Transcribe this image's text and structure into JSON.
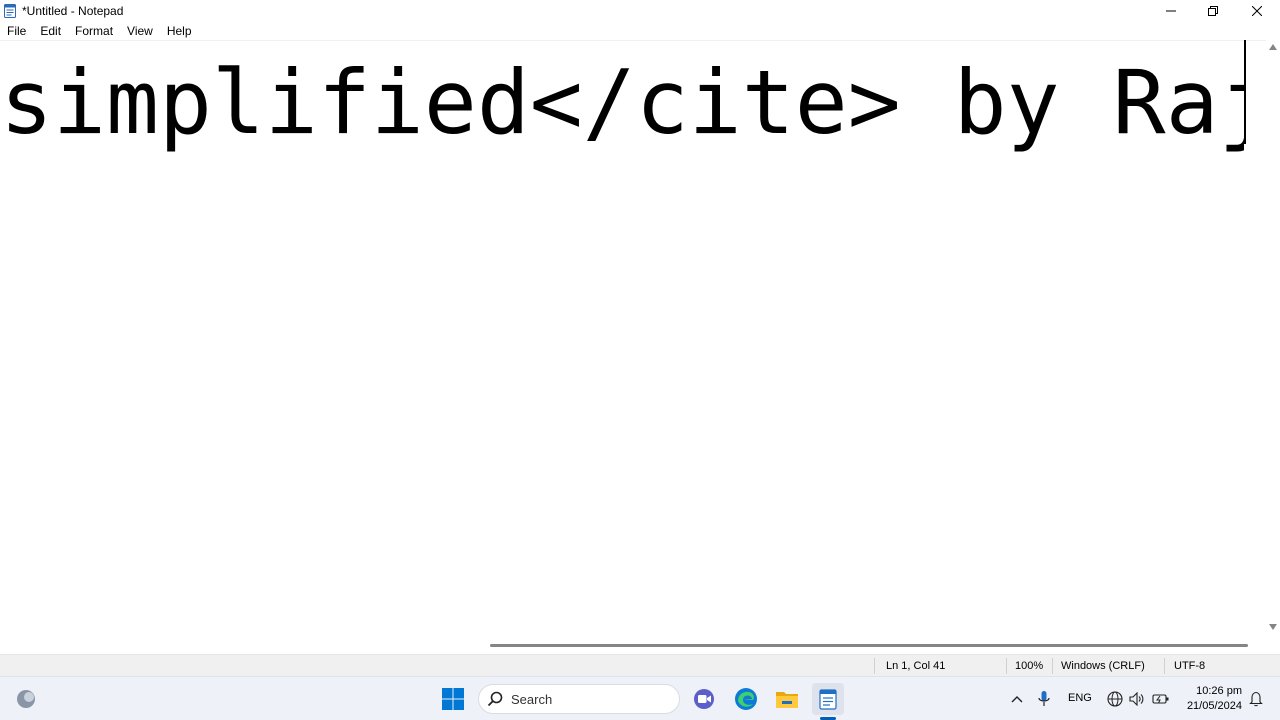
{
  "window": {
    "title": "*Untitled - Notepad"
  },
  "menu": [
    "File",
    "Edit",
    "Format",
    "View",
    "Help"
  ],
  "editor": {
    "visible_text": "simplified</cite> by Raji"
  },
  "status": {
    "position": "Ln 1, Col 41",
    "zoom": "100%",
    "line_ending": "Windows (CRLF)",
    "encoding": "UTF-8"
  },
  "taskbar": {
    "search_label": "Search",
    "language": "ENG",
    "time": "10:26 pm",
    "date": "21/05/2024",
    "pinned": [
      "start-icon",
      "search-icon",
      "meet-icon",
      "edge-icon",
      "file-explorer-icon",
      "notepad-icon"
    ]
  },
  "colors": {
    "accent": "#005fb8",
    "taskbar_bg": "#eef1f7",
    "statusbar_bg": "#f0f0f0"
  }
}
